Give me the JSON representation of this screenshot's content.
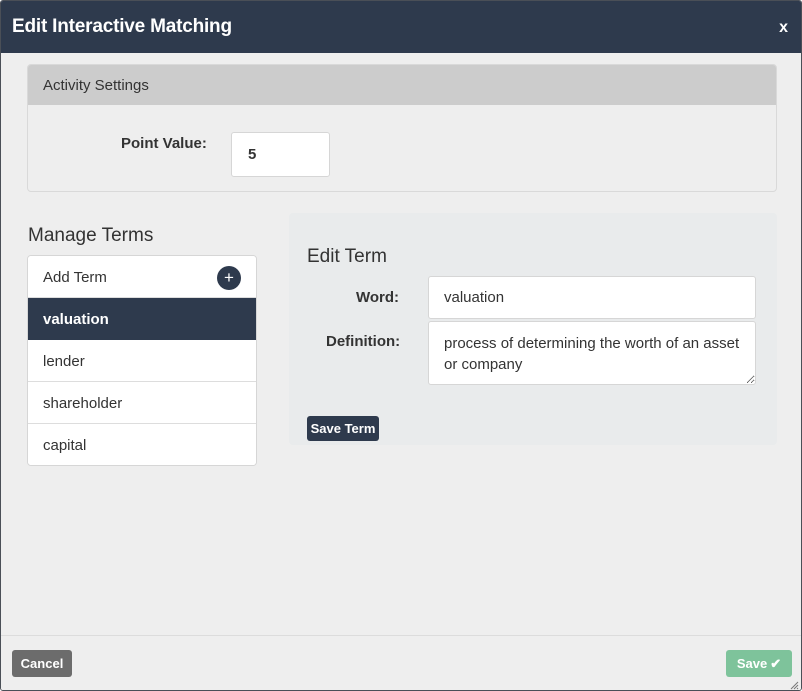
{
  "modal": {
    "title": "Edit Interactive Matching",
    "close_label": "x"
  },
  "activity_settings": {
    "heading": "Activity Settings",
    "point_value_label": "Point Value:",
    "point_value": "5"
  },
  "manage_terms": {
    "heading": "Manage Terms",
    "add_label": "Add Term",
    "add_icon": "plus-icon",
    "items": [
      {
        "label": "valuation",
        "selected": true
      },
      {
        "label": "lender",
        "selected": false
      },
      {
        "label": "shareholder",
        "selected": false
      },
      {
        "label": "capital",
        "selected": false
      }
    ]
  },
  "edit_term": {
    "heading": "Edit Term",
    "word_label": "Word:",
    "word_value": "valuation",
    "definition_label": "Definition:",
    "definition_value": "process of determining the worth of an asset or company",
    "save_label": "Save Term"
  },
  "footer": {
    "cancel_label": "Cancel",
    "save_label": "Save",
    "save_icon": "check-icon"
  },
  "colors": {
    "header_bg": "#2e3a4d",
    "selected_bg": "#2e3a4d",
    "save_bg": "#7ec39b",
    "cancel_bg": "#6c6c6c"
  }
}
